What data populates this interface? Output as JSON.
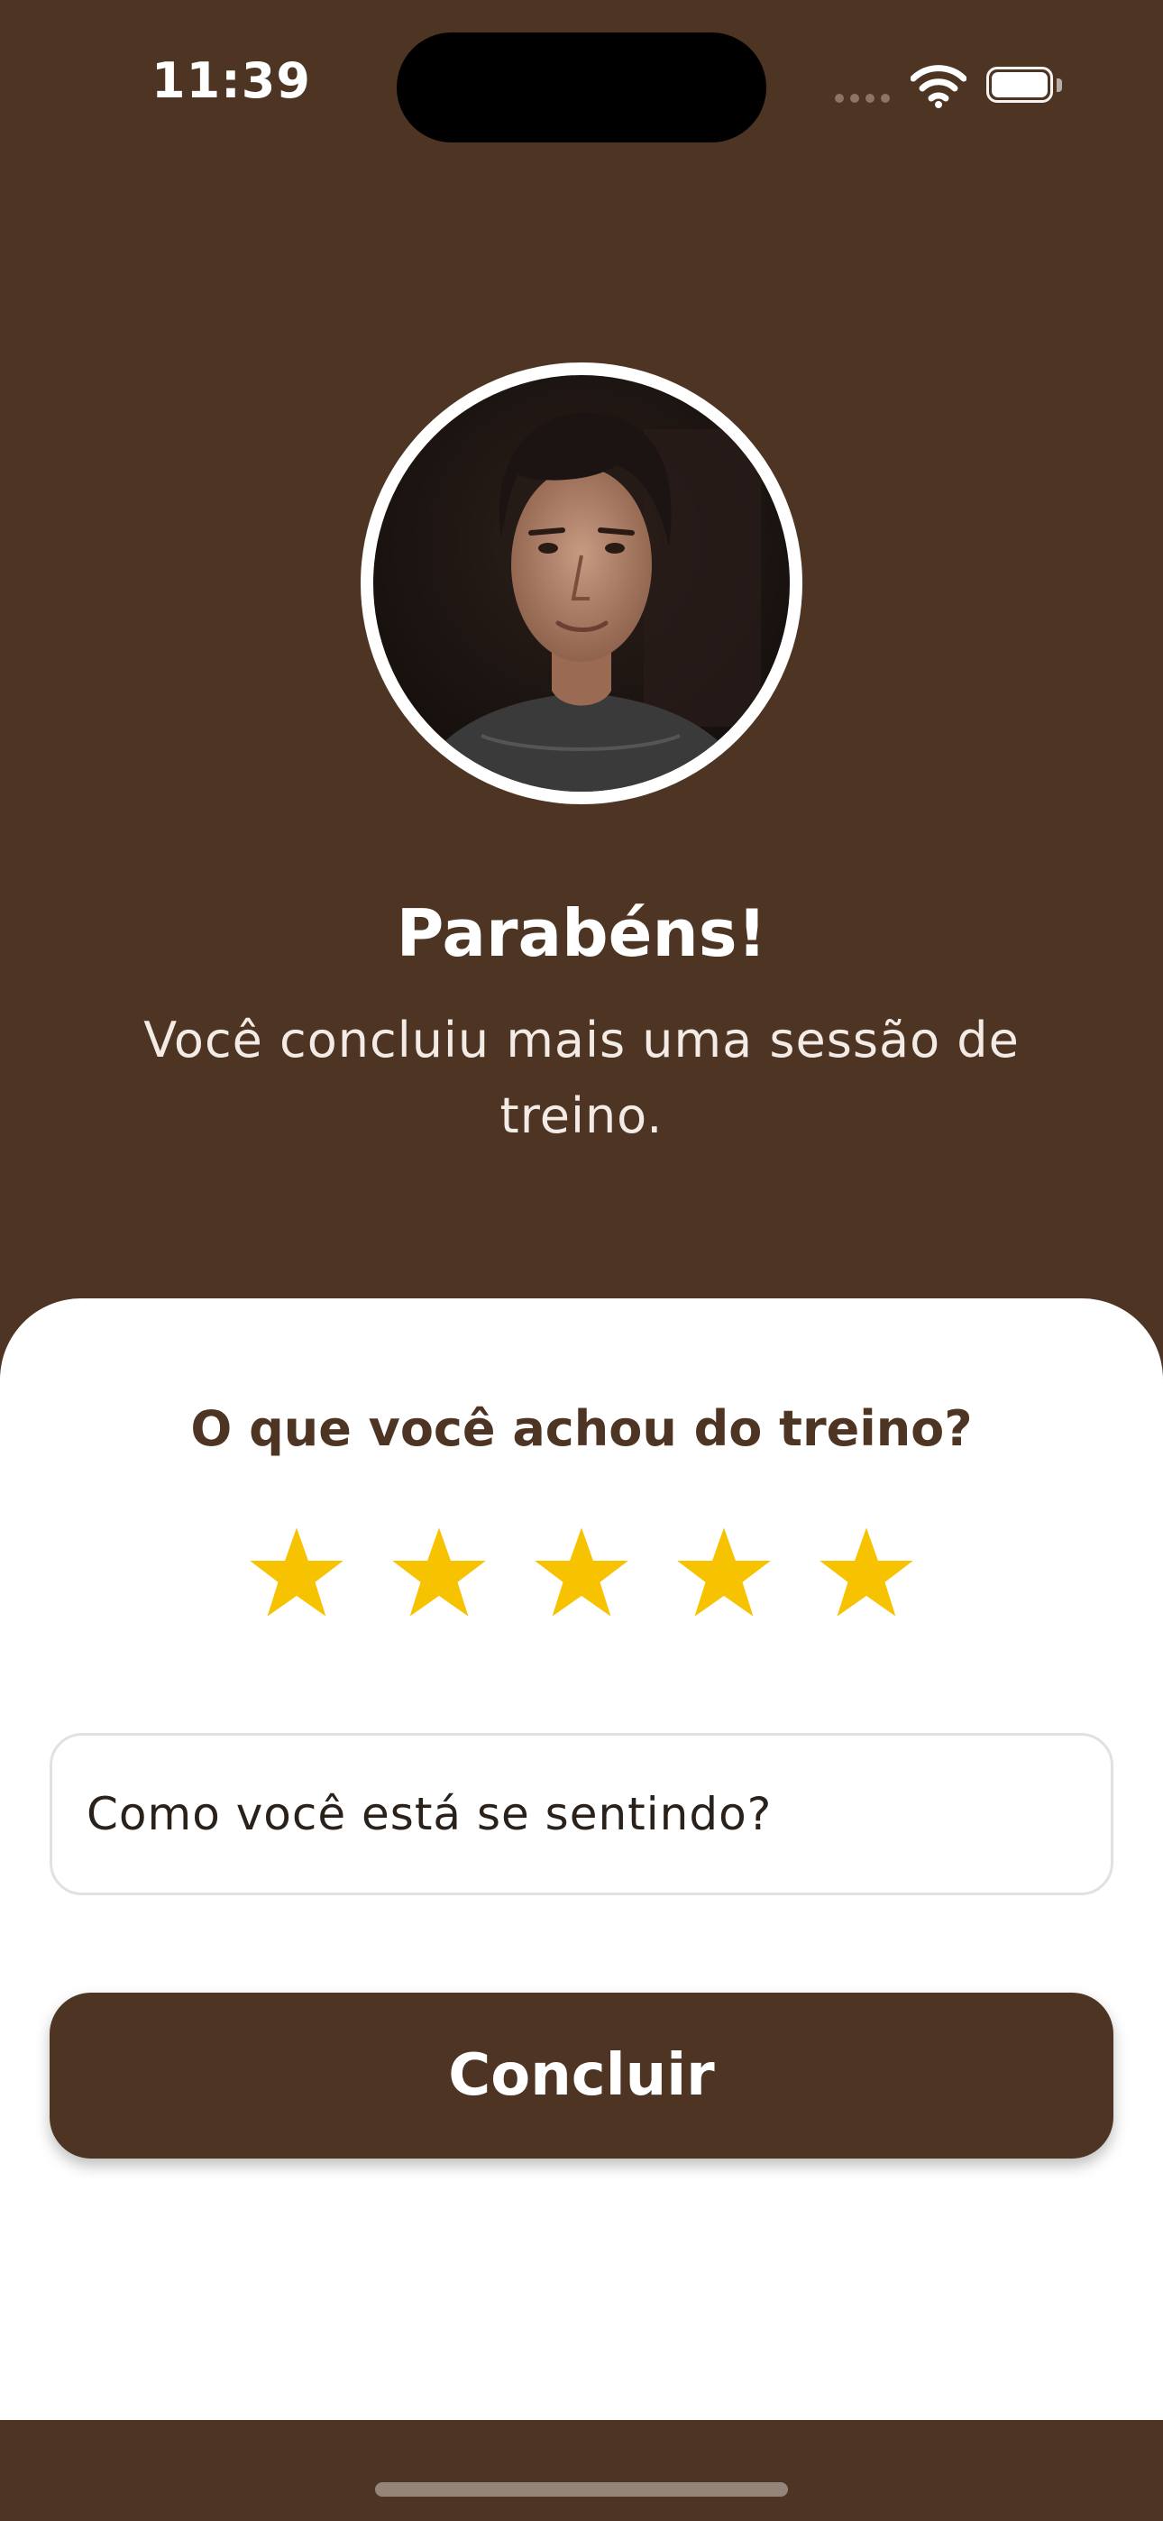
{
  "status_bar": {
    "time": "11:39",
    "icons": [
      "signal-dots-icon",
      "wifi-icon",
      "battery-icon"
    ]
  },
  "profile": {
    "avatar": "trainer-avatar-photo"
  },
  "header": {
    "title": "Parabéns!",
    "message": "Você concluiu mais uma sessão de treino."
  },
  "feedback": {
    "question": "O que você achou do treino?",
    "rating": 5,
    "rating_max": 5,
    "star_icon": "star-icon",
    "input_placeholder": "Como você está se sentindo?",
    "input_value": "",
    "submit_label": "Concluir"
  },
  "colors": {
    "brand_brown": "#4e3423",
    "star_yellow": "#f7c300",
    "sheet_background": "#ffffff"
  }
}
